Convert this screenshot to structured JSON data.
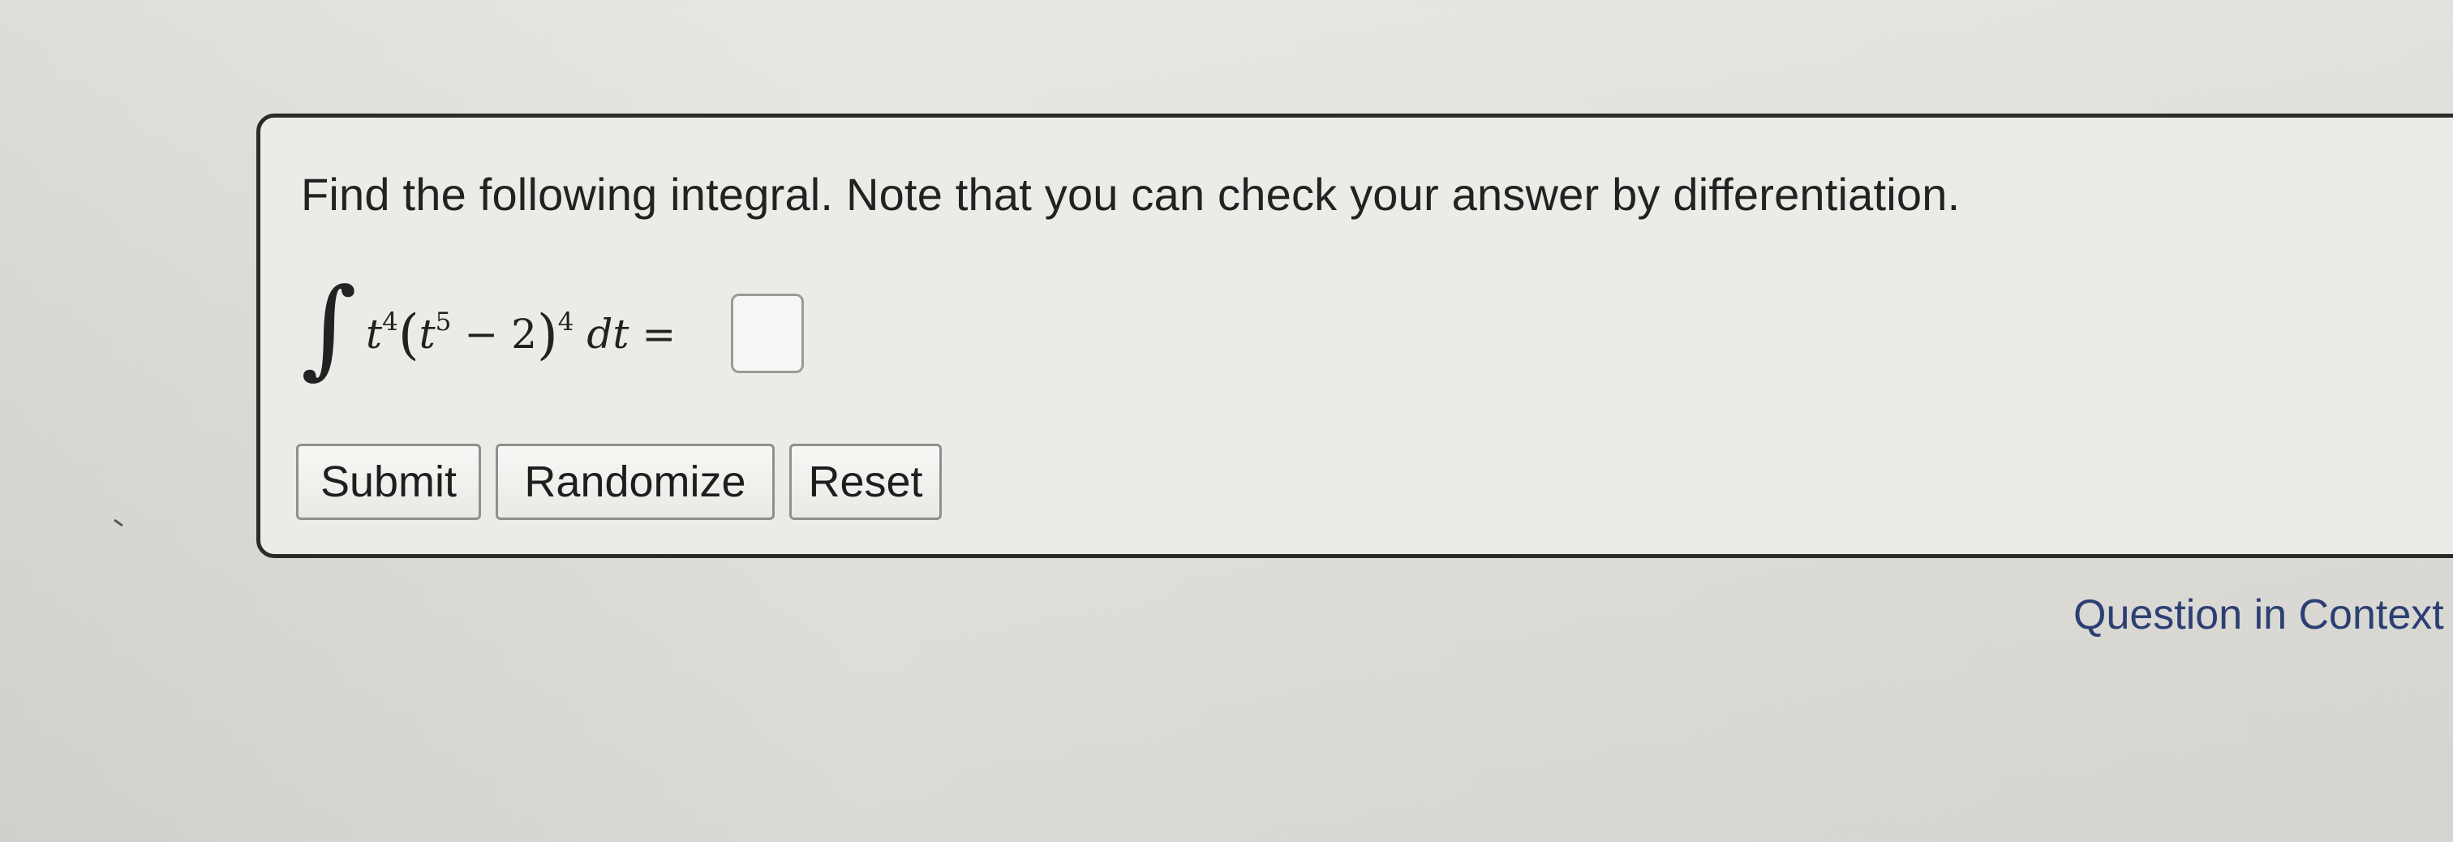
{
  "question": {
    "prompt": "Find the following integral. Note that you can check your answer by differentiation.",
    "integral_sign": "∫",
    "integrand": {
      "t": "t",
      "t_exponent": "4",
      "inner_t": "t",
      "inner_t_exponent": "5",
      "minus": "−",
      "constant": "2",
      "outer_exponent": "4",
      "differential": "dt",
      "equals": "="
    },
    "answer_value": ""
  },
  "buttons": {
    "submit": "Submit",
    "randomize": "Randomize",
    "reset": "Reset"
  },
  "footer": {
    "context_link": "Question in Context"
  }
}
